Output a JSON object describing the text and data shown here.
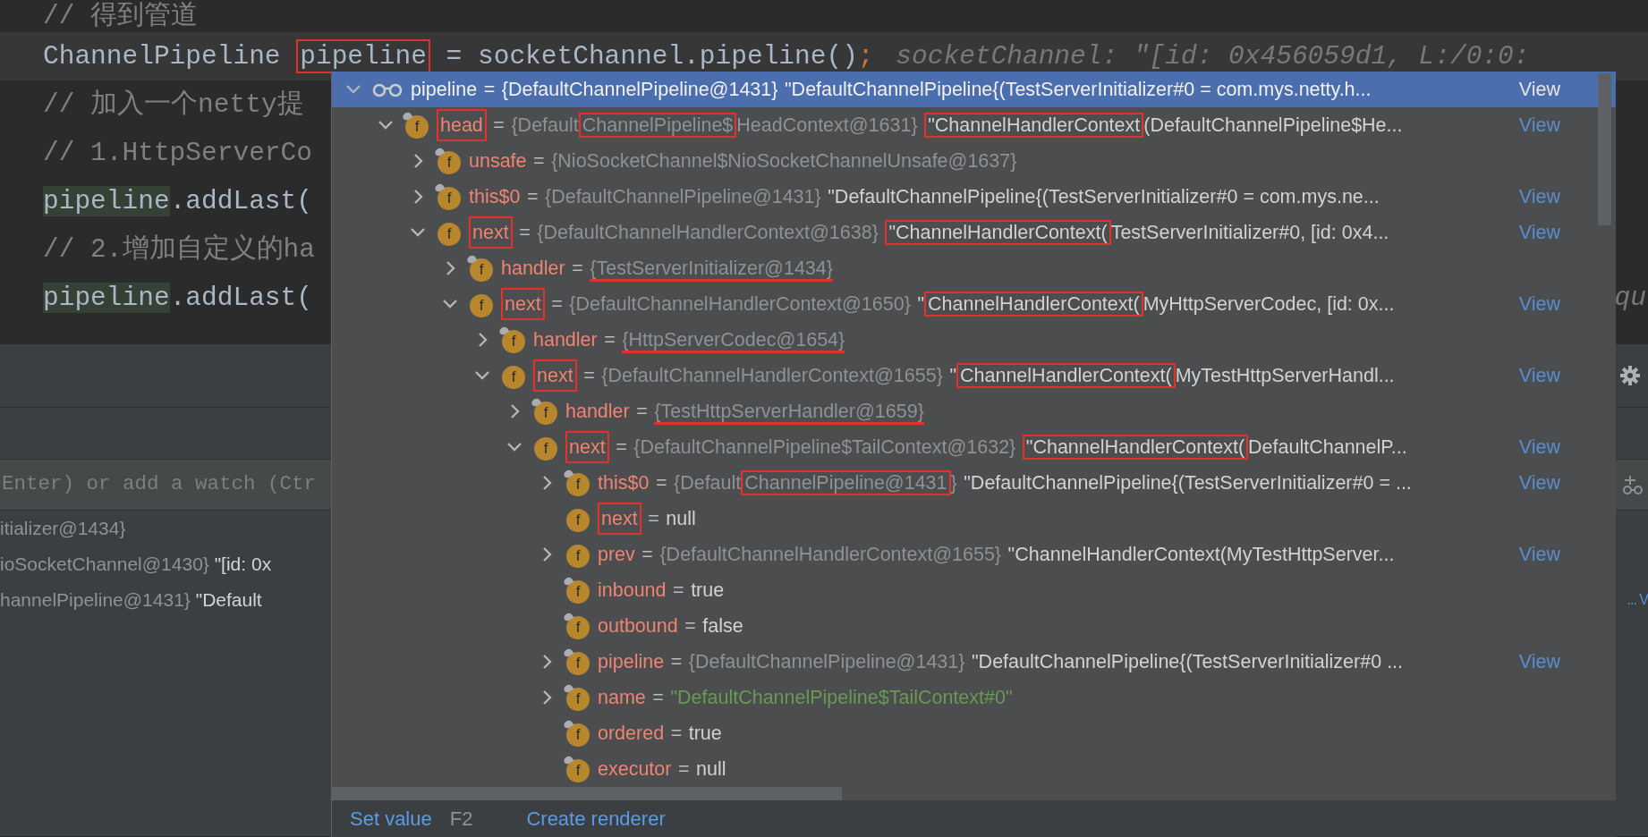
{
  "editor": {
    "lines": [
      {
        "current": false,
        "parts": [
          {
            "text": "// 得到管道",
            "kind": "comment"
          }
        ]
      },
      {
        "current": true,
        "parts": [
          {
            "text": "ChannelPipeline ",
            "kind": "code"
          },
          {
            "text": "pipeline",
            "kind": "code",
            "boxed": true
          },
          {
            "text": " = socketChannel.pipeline()",
            "kind": "code"
          },
          {
            "text": ";",
            "kind": "keyword"
          }
        ],
        "hint": {
          "text": "socketChannel: \"[id: 0x456059d1, L:/0:0:",
          "kind": "inline"
        }
      },
      {
        "current": false,
        "parts": [
          {
            "text": "// 加入一个netty提",
            "kind": "comment"
          }
        ]
      },
      {
        "current": false,
        "parts": [
          {
            "text": "// 1.HttpServerCo",
            "kind": "comment"
          }
        ]
      },
      {
        "current": false,
        "parts": [
          {
            "text": "pipeline",
            "kind": "usage"
          },
          {
            "text": ".addLast(",
            "kind": "code"
          }
        ]
      },
      {
        "current": false,
        "parts": [
          {
            "text": "// 2.增加自定义的ha",
            "kind": "comment"
          }
        ]
      },
      {
        "current": false,
        "parts": [
          {
            "text": "pipeline",
            "kind": "usage"
          },
          {
            "text": ".addLast(",
            "kind": "code"
          }
        ],
        "hint": {
          "text": "qu",
          "kind": "tail"
        }
      }
    ]
  },
  "debugger": {
    "watch_field": {
      "placeholder": "Enter) or add a watch (Ctr"
    },
    "variables": [
      {
        "type": "itializer@1434}"
      },
      {
        "type": "ioSocketChannel@1430}",
        "string": "\"[id: 0x"
      },
      {
        "type": "hannelPipeline@1431}",
        "string": "\"Default",
        "tail": "... V"
      }
    ]
  },
  "popup": {
    "tree": [
      {
        "kind": "watch",
        "name": "pipeline",
        "op": "=",
        "expanded": true,
        "selected": true,
        "type": [
          {
            "text": "{DefaultChannelPipeline@1431}"
          }
        ],
        "string": [
          {
            "text": "\"DefaultChannelPipeline{(TestServerInitializer#0 = com.mys.netty.h..."
          }
        ],
        "view": "View",
        "children": [
          {
            "kind": "field",
            "icon": "f",
            "pinned": true,
            "name": "head",
            "boxed": true,
            "op": "=",
            "expanded": true,
            "selected": false,
            "type": [
              {
                "text": "{Default"
              },
              {
                "text": "ChannelPipeline$",
                "boxed": true
              },
              {
                "text": "HeadContext@1631}"
              }
            ],
            "string": [
              {
                "text": "\"ChannelHandlerContext",
                "boxed": true
              },
              {
                "text": "(DefaultChannelPipeline$He..."
              }
            ],
            "view": "View",
            "children": [
              {
                "kind": "field",
                "icon": "f",
                "pinned": true,
                "name": "unsafe",
                "op": "=",
                "expanded": false,
                "selected": false,
                "type": [
                  {
                    "text": "{NioSocketChannel$NioSocketChannelUnsafe@1637}"
                  }
                ]
              },
              {
                "kind": "field",
                "icon": "f",
                "pinned": true,
                "name": "this$0",
                "op": "=",
                "expanded": false,
                "selected": false,
                "type": [
                  {
                    "text": "{DefaultChannelPipeline@1431}"
                  }
                ],
                "string": [
                  {
                    "text": "\"DefaultChannelPipeline{(TestServerInitializer#0 = com.mys.ne..."
                  }
                ],
                "view": "View"
              },
              {
                "kind": "field",
                "icon": "f",
                "pinned": false,
                "name": "next",
                "boxed": true,
                "op": "=",
                "expanded": true,
                "selected": false,
                "type": [
                  {
                    "text": "{DefaultChannelHandlerContext@1638}"
                  }
                ],
                "string": [
                  {
                    "text": "\"ChannelHandlerContext(",
                    "boxed": true
                  },
                  {
                    "text": "TestServerInitializer#0, [id: 0x4..."
                  }
                ],
                "view": "View",
                "children": [
                  {
                    "kind": "field",
                    "icon": "f",
                    "pinned": true,
                    "name": "handler",
                    "op": "=",
                    "expanded": false,
                    "selected": false,
                    "type": [
                      {
                        "text": "{TestServerInitializer@1434}",
                        "underlined": true
                      }
                    ]
                  },
                  {
                    "kind": "field",
                    "icon": "f",
                    "pinned": false,
                    "name": "next",
                    "boxed": true,
                    "op": "=",
                    "expanded": true,
                    "selected": false,
                    "type": [
                      {
                        "text": "{DefaultChannelHandlerContext@1650}"
                      }
                    ],
                    "string": [
                      {
                        "text": "\""
                      },
                      {
                        "text": "ChannelHandlerContext(",
                        "boxed": true
                      },
                      {
                        "text": "MyHttpServerCodec, [id: 0x..."
                      }
                    ],
                    "view": "View",
                    "children": [
                      {
                        "kind": "field",
                        "icon": "f",
                        "pinned": true,
                        "name": "handler",
                        "op": "=",
                        "expanded": false,
                        "selected": false,
                        "type": [
                          {
                            "text": "{HttpServerCodec@1654}",
                            "underlined": true
                          }
                        ]
                      },
                      {
                        "kind": "field",
                        "icon": "f",
                        "pinned": false,
                        "name": "next",
                        "boxed": true,
                        "op": "=",
                        "expanded": true,
                        "selected": false,
                        "type": [
                          {
                            "text": "{DefaultChannelHandlerContext@1655}"
                          }
                        ],
                        "string": [
                          {
                            "text": "\""
                          },
                          {
                            "text": "ChannelHandlerContext(",
                            "boxed": true
                          },
                          {
                            "text": "MyTestHttpServerHandl..."
                          }
                        ],
                        "view": "View",
                        "children": [
                          {
                            "kind": "field",
                            "icon": "f",
                            "pinned": true,
                            "name": "handler",
                            "op": "=",
                            "expanded": false,
                            "selected": false,
                            "type": [
                              {
                                "text": "{TestHttpServerHandler@1659}",
                                "underlined": true
                              }
                            ]
                          },
                          {
                            "kind": "field",
                            "icon": "f",
                            "pinned": false,
                            "name": "next",
                            "boxed": true,
                            "op": "=",
                            "expanded": true,
                            "selected": false,
                            "type": [
                              {
                                "text": "{DefaultChannelPipeline$TailContext@1632}"
                              }
                            ],
                            "string": [
                              {
                                "text": "\"ChannelHandlerContext(",
                                "boxed": true
                              },
                              {
                                "text": "DefaultChannelP..."
                              }
                            ],
                            "view": "View",
                            "children": [
                              {
                                "kind": "field",
                                "icon": "f",
                                "pinned": true,
                                "name": "this$0",
                                "op": "=",
                                "expanded": false,
                                "selected": false,
                                "type": [
                                  {
                                    "text": "{Default"
                                  },
                                  {
                                    "text": "ChannelPipeline@1431",
                                    "boxed": true
                                  },
                                  {
                                    "text": "}"
                                  }
                                ],
                                "string": [
                                  {
                                    "text": "\"DefaultChannelPipeline{(TestServerInitializer#0 = ..."
                                  }
                                ],
                                "view": "View"
                              },
                              {
                                "kind": "field",
                                "icon": "f",
                                "pinned": false,
                                "name": "next",
                                "boxed": true,
                                "op": "=",
                                "selected": false,
                                "literal": {
                                  "text": "null",
                                  "kind": "plain"
                                }
                              },
                              {
                                "kind": "field",
                                "icon": "f",
                                "pinned": false,
                                "name": "prev",
                                "op": "=",
                                "expanded": false,
                                "selected": false,
                                "type": [
                                  {
                                    "text": "{DefaultChannelHandlerContext@1655}"
                                  }
                                ],
                                "string": [
                                  {
                                    "text": "\"ChannelHandlerContext(MyTestHttpServer..."
                                  }
                                ],
                                "view": "View"
                              },
                              {
                                "kind": "field",
                                "icon": "f",
                                "pinned": true,
                                "name": "inbound",
                                "op": "=",
                                "selected": false,
                                "literal": {
                                  "text": "true",
                                  "kind": "plain"
                                }
                              },
                              {
                                "kind": "field",
                                "icon": "f",
                                "pinned": true,
                                "name": "outbound",
                                "op": "=",
                                "selected": false,
                                "literal": {
                                  "text": "false",
                                  "kind": "plain"
                                }
                              },
                              {
                                "kind": "field",
                                "icon": "f",
                                "pinned": true,
                                "name": "pipeline",
                                "op": "=",
                                "expanded": false,
                                "selected": false,
                                "type": [
                                  {
                                    "text": "{DefaultChannelPipeline@1431}"
                                  }
                                ],
                                "string": [
                                  {
                                    "text": "\"DefaultChannelPipeline{(TestServerInitializer#0 ..."
                                  }
                                ],
                                "view": "View"
                              },
                              {
                                "kind": "field",
                                "icon": "f",
                                "pinned": true,
                                "name": "name",
                                "op": "=",
                                "expanded": false,
                                "selected": false,
                                "literal": {
                                  "text": "\"DefaultChannelPipeline$TailContext#0\"",
                                  "kind": "string"
                                }
                              },
                              {
                                "kind": "field",
                                "icon": "f",
                                "pinned": true,
                                "name": "ordered",
                                "op": "=",
                                "selected": false,
                                "literal": {
                                  "text": "true",
                                  "kind": "plain"
                                }
                              },
                              {
                                "kind": "field",
                                "icon": "f",
                                "pinned": true,
                                "name": "executor",
                                "op": "=",
                                "selected": false,
                                "literal": {
                                  "text": "null",
                                  "kind": "plain"
                                }
                              }
                            ]
                          }
                        ]
                      }
                    ]
                  }
                ]
              }
            ]
          }
        ]
      }
    ],
    "actions": [
      {
        "label": "Set value",
        "kind": "link"
      },
      {
        "label": "F2",
        "kind": "shortcut"
      },
      {
        "label": "Create renderer",
        "kind": "link"
      }
    ]
  }
}
